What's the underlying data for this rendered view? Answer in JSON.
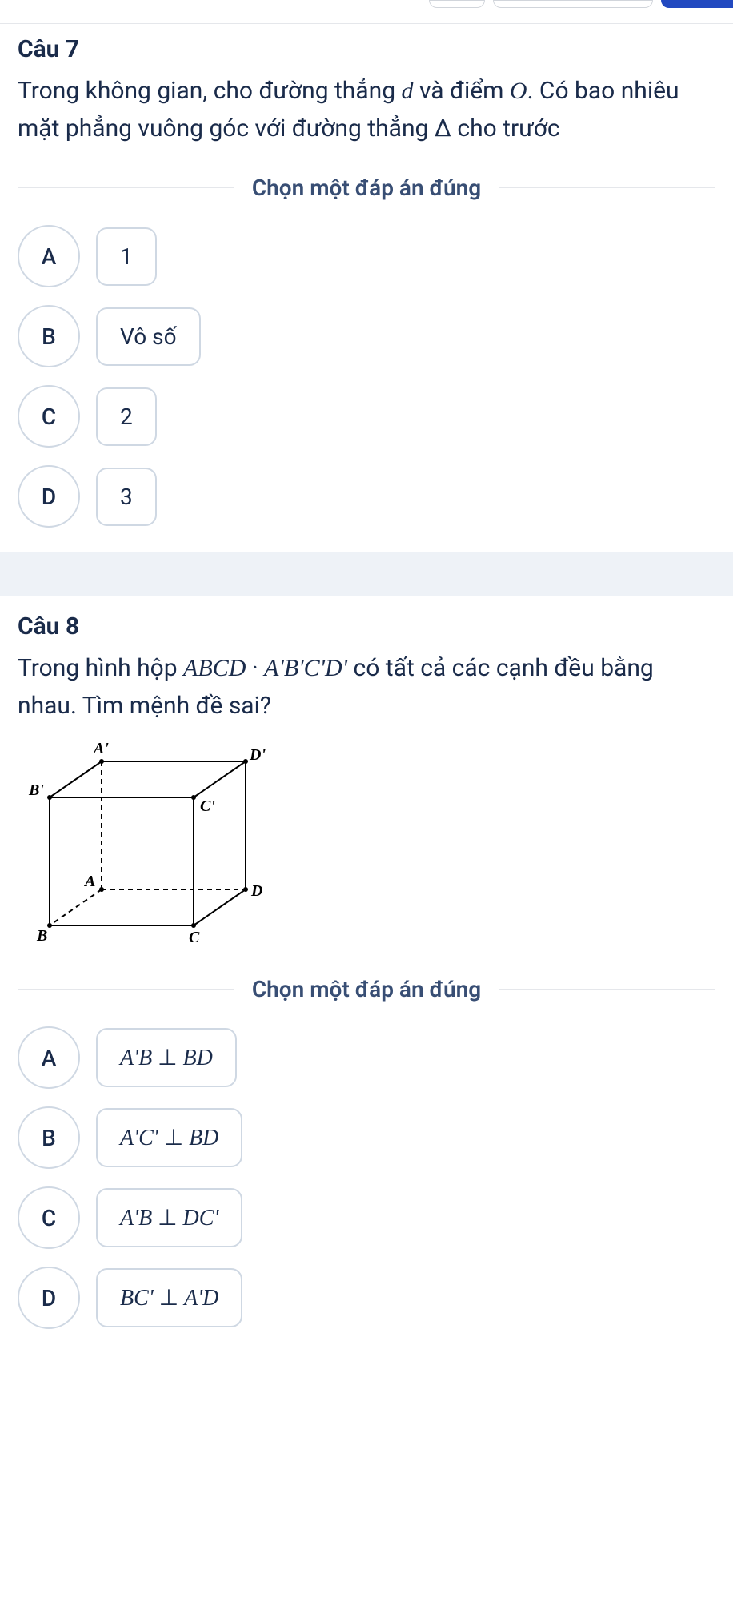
{
  "q7": {
    "title": "Câu 7",
    "text_part1": "Trong không gian, cho đường thẳng ",
    "d": "d",
    "text_part2": " và điểm ",
    "O": "O",
    "text_part3": ". Có bao nhiêu mặt phẳng vuông góc với đường thẳng Δ cho trước",
    "instruction": "Chọn một đáp án đúng",
    "options": {
      "A": {
        "letter": "A",
        "text": "1"
      },
      "B": {
        "letter": "B",
        "text": "Vô số"
      },
      "C": {
        "letter": "C",
        "text": "2"
      },
      "D": {
        "letter": "D",
        "text": "3"
      }
    }
  },
  "q8": {
    "title": "Câu 8",
    "text_part1": "Trong hình hộp ",
    "abcd": "ABCD",
    "dot": "·",
    "abcd2": "A'B'C'D'",
    "text_part2": " có tất cả các cạnh đều bằng nhau. Tìm mệnh đề sai?",
    "instruction": "Chọn một đáp án đúng",
    "cube_labels": {
      "A": "A",
      "B": "B",
      "C": "C",
      "D": "D",
      "A1": "A'",
      "B1": "B'",
      "C1": "C'",
      "D1": "D'"
    },
    "options": {
      "A": {
        "letter": "A",
        "l": "A'B",
        "r": "BD"
      },
      "B": {
        "letter": "B",
        "l": "A'C'",
        "r": "BD"
      },
      "C": {
        "letter": "C",
        "l": "A'B",
        "r": "DC'"
      },
      "D": {
        "letter": "D",
        "l": "BC'",
        "r": "A'D"
      }
    },
    "perp": "⊥"
  }
}
